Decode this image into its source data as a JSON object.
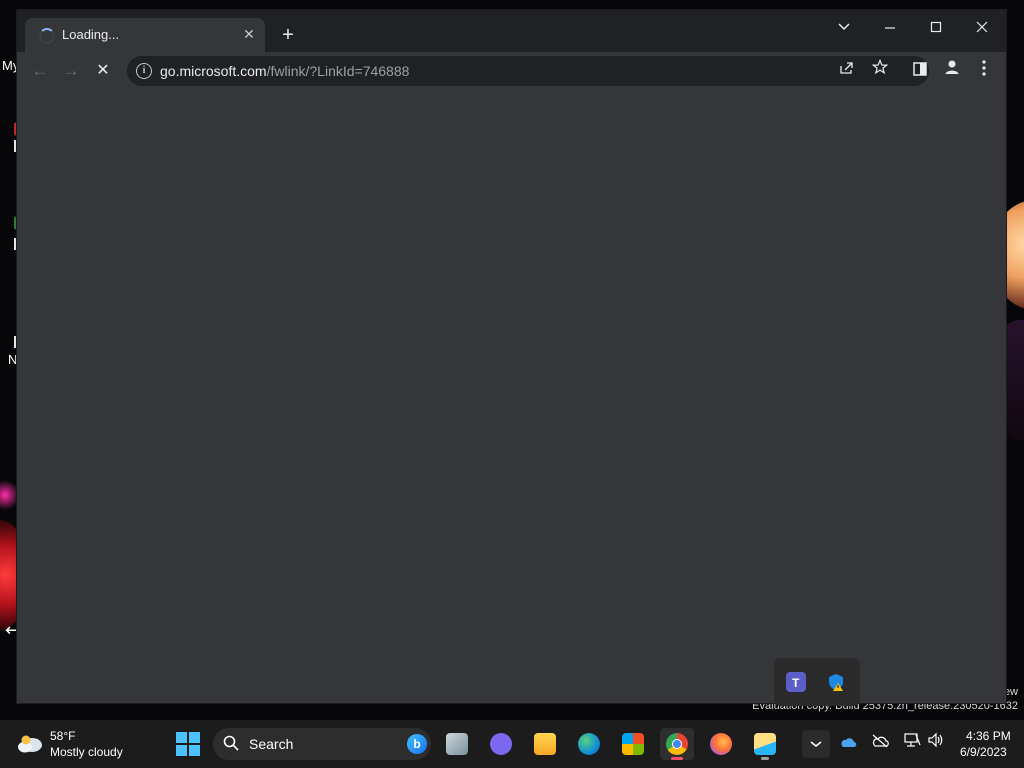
{
  "desktop": {
    "labels": [
      "My",
      "N"
    ],
    "eval_suffix": "ew",
    "evaluation_text": "Evaluation copy. Build 25375.zn_release.230520-1632"
  },
  "browser": {
    "tab": {
      "title": "Loading...",
      "state": "loading"
    },
    "new_tab_label": "+",
    "window_controls": {
      "tab_search": "⌄",
      "minimize": "—",
      "maximize": "☐",
      "close": "✕"
    },
    "toolbar": {
      "back": "←",
      "forward": "→",
      "stop": "✕",
      "url_host": "go.microsoft.com",
      "url_path": "/fwlink/?LinkId=746888"
    },
    "accent_color": "#8ab4f8"
  },
  "taskbar": {
    "weather": {
      "temperature": "58°F",
      "condition": "Mostly cloudy"
    },
    "search_placeholder": "Search",
    "apps": [
      "task-view",
      "meet-chat",
      "file-explorer",
      "edge",
      "microsoft-store",
      "chrome",
      "firefox",
      "files-app"
    ],
    "tray_icons": [
      "chevron-up",
      "onedrive",
      "onedrive-off",
      "network",
      "volume"
    ],
    "clock": {
      "time": "4:36 PM",
      "date": "6/9/2023"
    }
  }
}
